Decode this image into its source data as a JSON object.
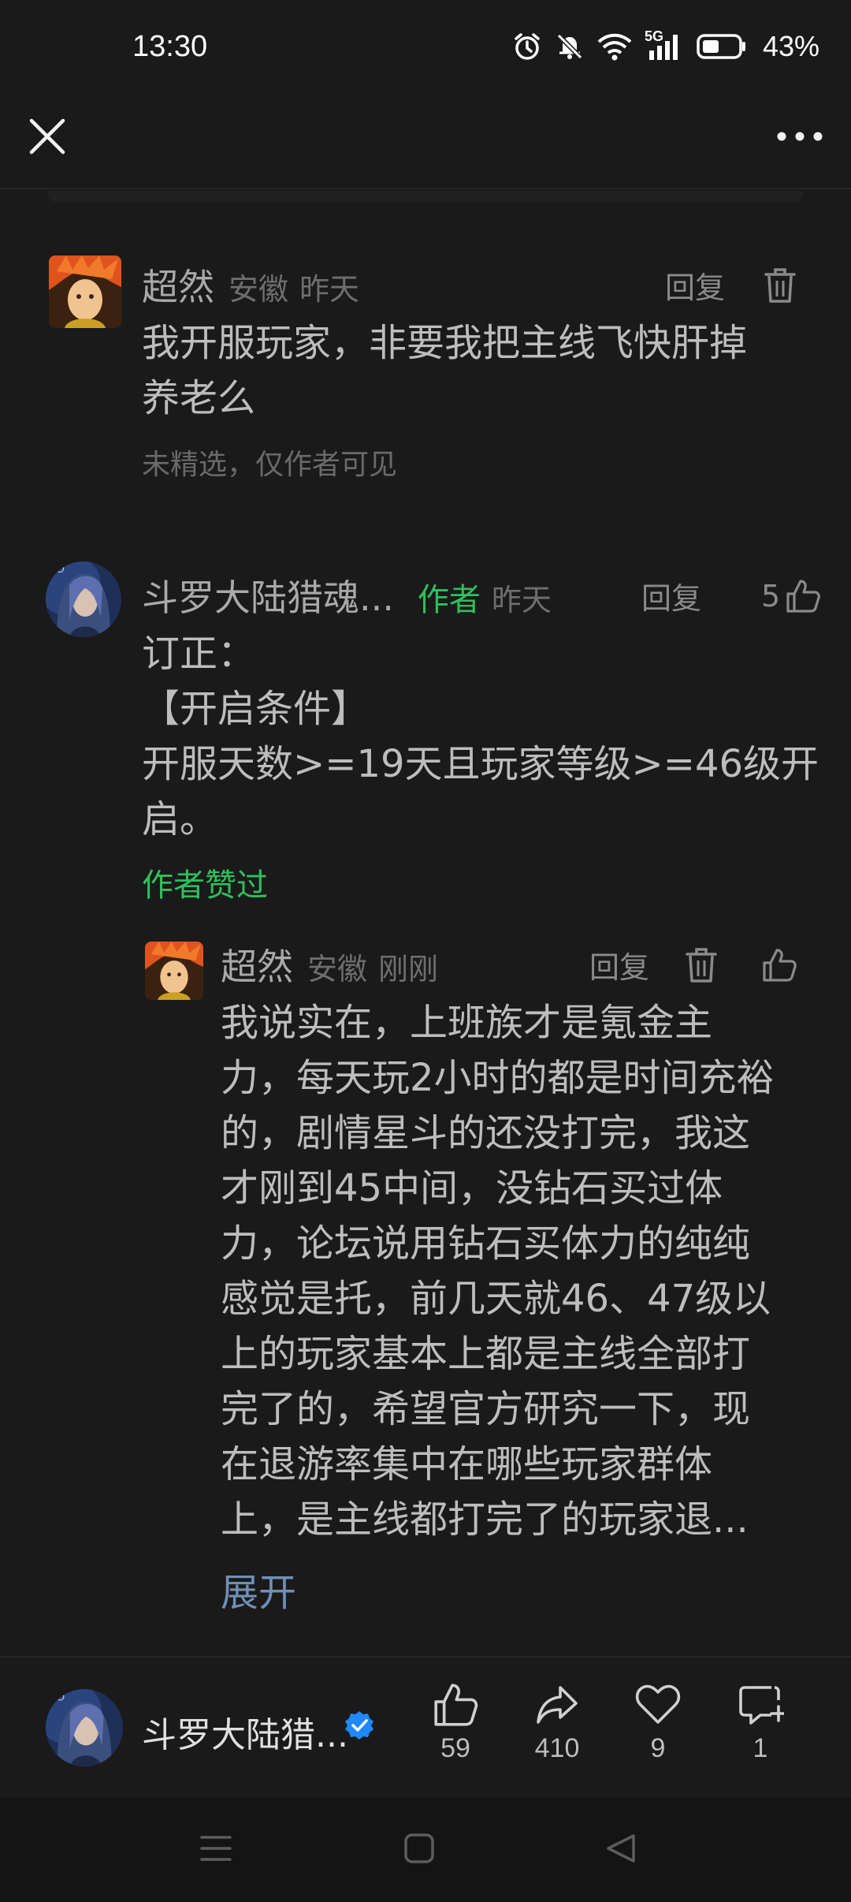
{
  "status_bar": {
    "time": "13:30",
    "network": "5G",
    "battery": "43%",
    "icons": [
      "alarm-icon",
      "mute-icon",
      "wifi-icon",
      "signal-icon",
      "battery-icon"
    ]
  },
  "header": {
    "close_icon": "close-icon",
    "more_icon": "more-icon"
  },
  "comments": [
    {
      "name": "超然",
      "location": "安徽",
      "time": "昨天",
      "reply": "回复",
      "body_lines": [
        "我开服玩家，非要我把主线飞快肝掉",
        "养老么"
      ],
      "note": "未精选，仅作者可见"
    },
    {
      "name": "斗罗大陆猎魂...",
      "author_tag": "作者",
      "time": "昨天",
      "reply": "回复",
      "likes": "5",
      "body_lines": [
        "订正：",
        "【开启条件】",
        "开服天数>=19天且玩家等级>=46级开",
        "启。"
      ],
      "liked_note": "作者赞过"
    },
    {
      "name": "超然",
      "location": "安徽",
      "time": "刚刚",
      "reply": "回复",
      "body_lines": [
        "我说实在，上班族才是氪金主",
        "力，每天玩2小时的都是时间充裕",
        "的，剧情星斗的还没打完，我这",
        "才刚到45中间，没钻石买过体",
        "力，论坛说用钻石买体力的纯纯",
        "感觉是托，前几天就46、47级以",
        "上的玩家基本上都是主线全部打",
        "完了的，希望官方研究一下，现",
        "在退游率集中在哪些玩家群体",
        "上，是主线都打完了的玩家退..."
      ],
      "expand": "展开"
    }
  ],
  "bottom_bar": {
    "author_name": "斗罗大陆猎...",
    "like_count": "59",
    "share_count": "410",
    "favorite_count": "9",
    "comment_count": "1"
  },
  "colors": {
    "background": "#1a1a1a",
    "author_green": "#2fbf5d",
    "link_blue": "#6f8fb5",
    "verified_blue": "#1e88ff"
  }
}
